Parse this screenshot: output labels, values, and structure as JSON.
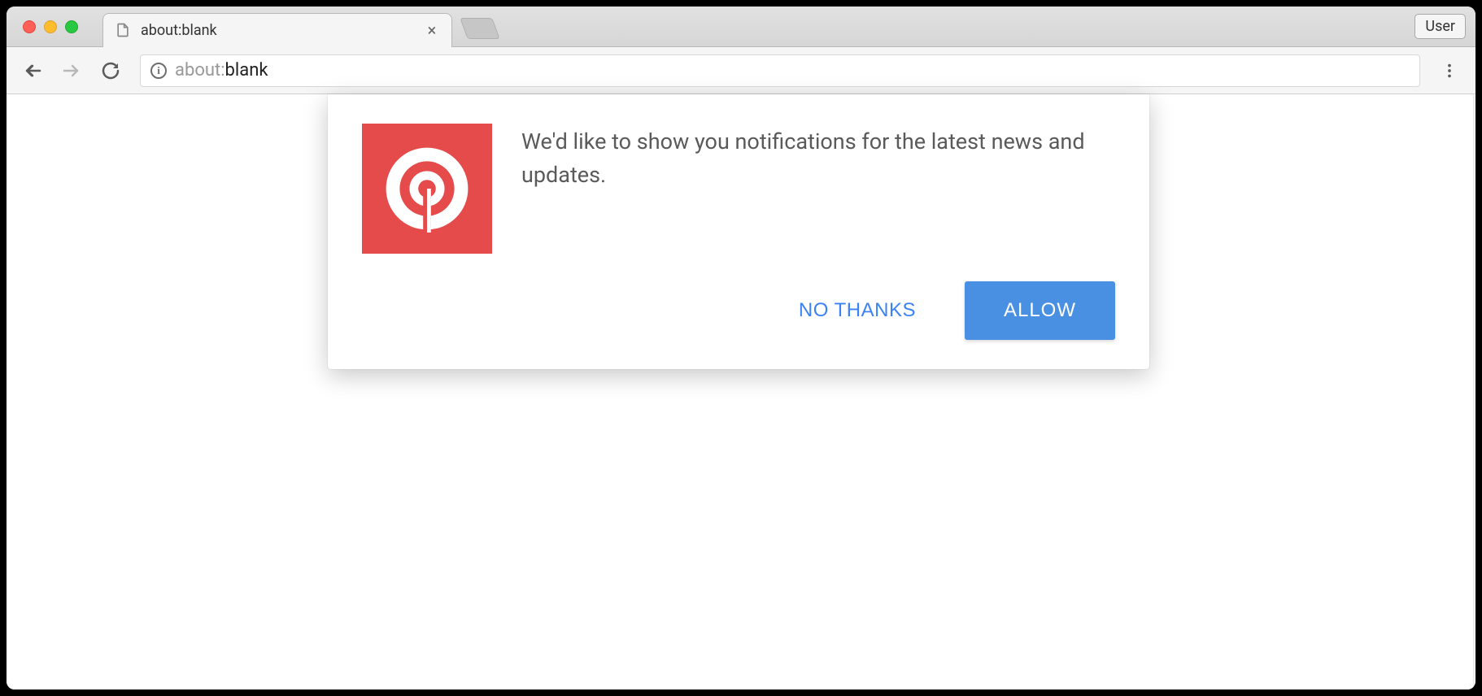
{
  "window": {
    "user_badge": "User"
  },
  "tab": {
    "title": "about:blank"
  },
  "toolbar": {
    "url_scheme": "about:",
    "url_path": "blank"
  },
  "dialog": {
    "message": "We'd like to show you notifications for the latest news and updates.",
    "decline_label": "NO THANKS",
    "accept_label": "ALLOW"
  },
  "icons": {
    "app_icon": "onesignal-icon"
  },
  "colors": {
    "accent_red": "#e54b4b",
    "accent_blue": "#4a90e2",
    "link_blue": "#3b82f6"
  }
}
